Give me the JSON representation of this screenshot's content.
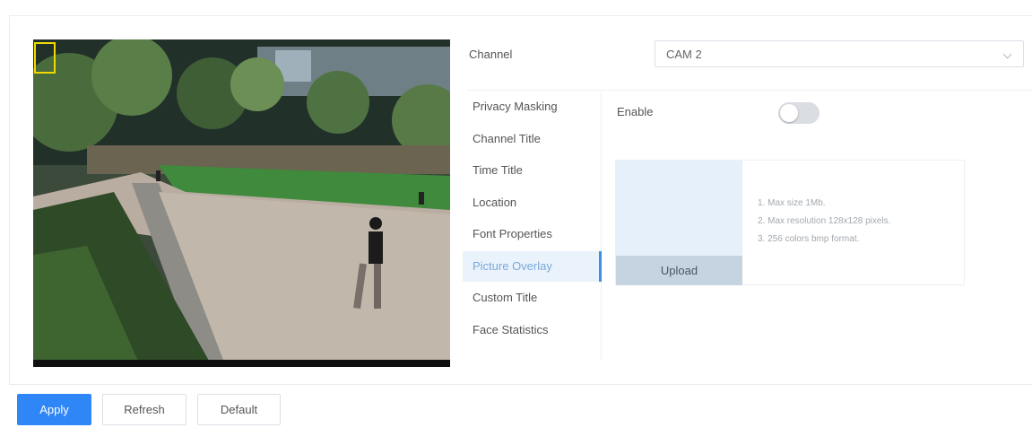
{
  "video": {
    "overlay_text": ""
  },
  "channel": {
    "label": "Channel",
    "value": "CAM 2"
  },
  "menu": {
    "items": [
      {
        "label": "Privacy Masking"
      },
      {
        "label": "Channel Title"
      },
      {
        "label": "Time Title"
      },
      {
        "label": "Location"
      },
      {
        "label": "Font Properties"
      },
      {
        "label": "Picture Overlay"
      },
      {
        "label": "Custom Title"
      },
      {
        "label": "Face Statistics"
      }
    ],
    "active_index": 5
  },
  "picture_overlay": {
    "enable_label": "Enable",
    "enabled": false,
    "upload_label": "Upload",
    "notes": [
      "1. Max size 1Mb.",
      "2. Max resolution 128x128 pixels.",
      "3. 256 colors bmp format."
    ]
  },
  "footer": {
    "apply_label": "Apply",
    "refresh_label": "Refresh",
    "default_label": "Default"
  },
  "colors": {
    "accent": "#2f86f6",
    "active_bg": "#eaf3fc",
    "active_text": "#7aa8d8"
  }
}
